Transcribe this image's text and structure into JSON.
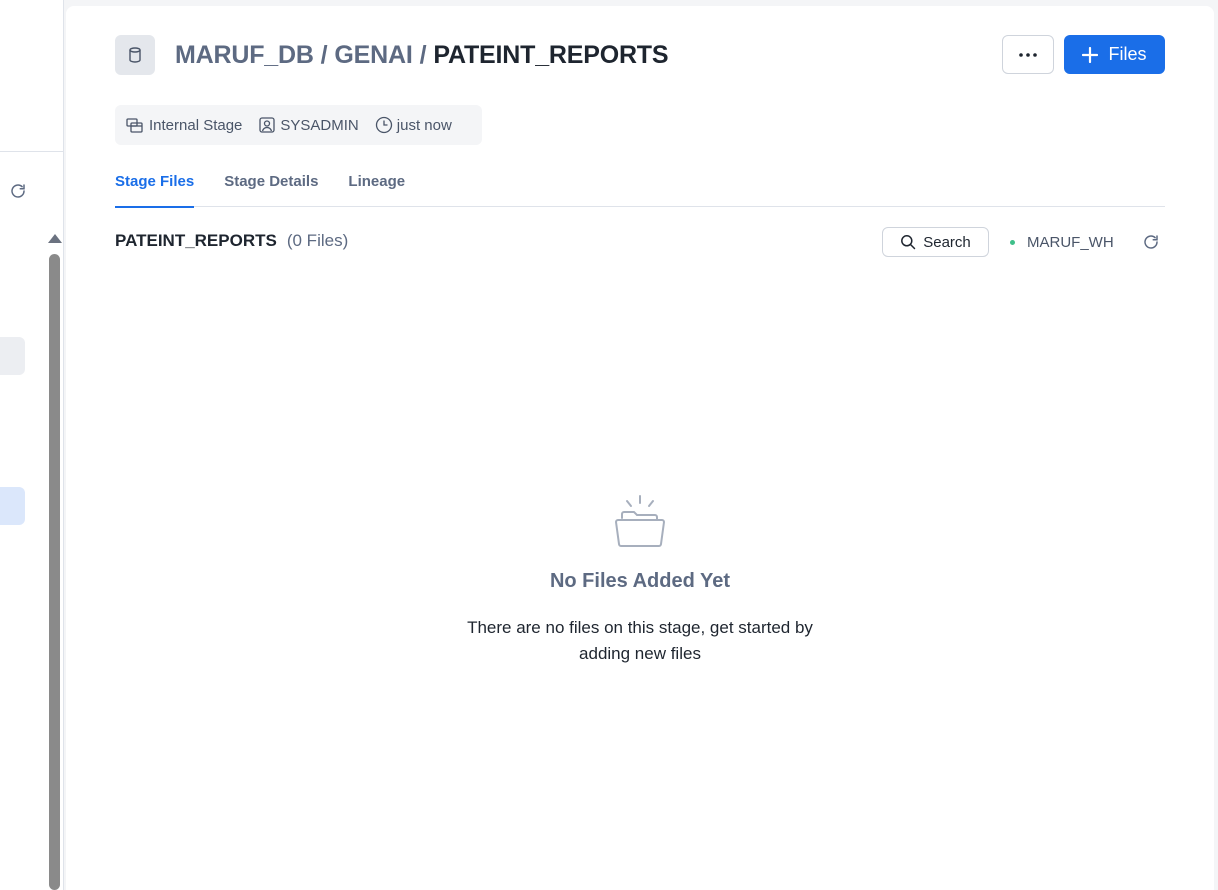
{
  "breadcrumb": {
    "database": "MARUF_DB",
    "schema": "GENAI",
    "stage": "PATEINT_REPORTS",
    "separator": "/"
  },
  "header": {
    "more_label": "···",
    "add_files_label": "Files",
    "add_icon": "plus-icon"
  },
  "meta": {
    "type": "Internal Stage",
    "owner": "SYSADMIN",
    "updated": "just now"
  },
  "tabs": [
    {
      "label": "Stage Files",
      "active": true
    },
    {
      "label": "Stage Details",
      "active": false
    },
    {
      "label": "Lineage",
      "active": false
    }
  ],
  "files": {
    "title": "PATEINT_REPORTS",
    "count_label": "(0 Files)",
    "search_label": "Search",
    "warehouse": "MARUF_WH",
    "warehouse_status_color": "#3fbf8a"
  },
  "empty_state": {
    "title": "No Files Added Yet",
    "description": "There are no files on this stage, get started by adding new files"
  },
  "colors": {
    "accent": "#1a6ee8",
    "muted_text": "#5d6a82"
  }
}
